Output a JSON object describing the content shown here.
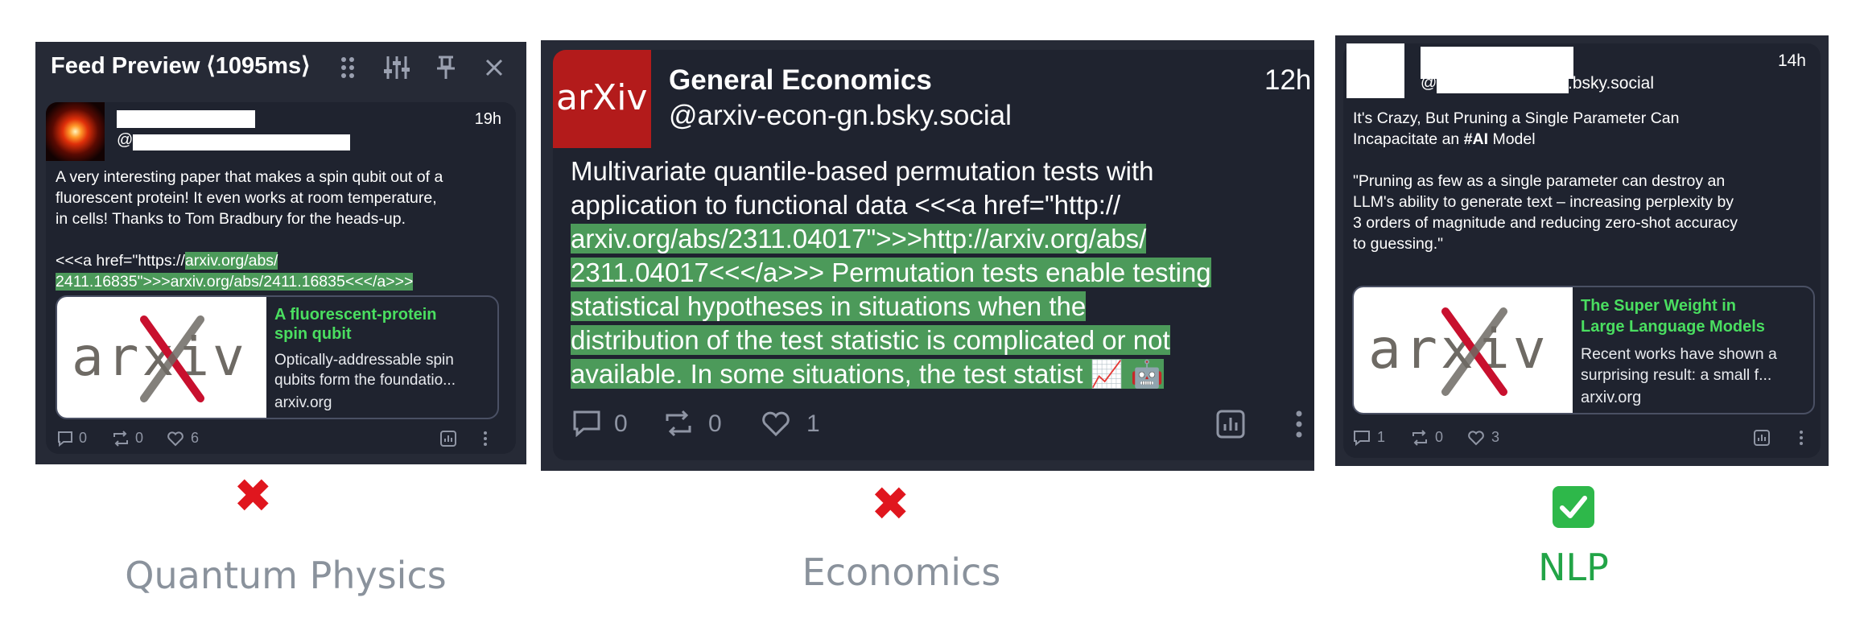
{
  "panel1": {
    "header_title": "Feed Preview ⟨1095ms⟩",
    "time": "19h",
    "handle_at": "@",
    "text_lines": [
      "A very interesting paper that makes a spin qubit out of a",
      "fluorescent protein! It even works at room temperature,",
      "in cells! Thanks to Tom Bradbury for the heads-up."
    ],
    "html_line1_plain": "<<<a href=\"https://",
    "html_line1_hl": "arxiv.org/abs/",
    "html_line2_hl": "2411.16835\">>>arxiv.org/abs/2411.16835<<</a>>>",
    "link_title": [
      "A fluorescent-protein",
      "spin qubit"
    ],
    "link_desc": [
      "Optically-addressable spin",
      "qubits form the foundatio..."
    ],
    "link_domain": "arxiv.org",
    "logo_text": "arxiv",
    "counts": {
      "replies": "0",
      "reposts": "0",
      "likes": "6"
    }
  },
  "panel2": {
    "avatar_text": "arXiv",
    "name": "General Economics",
    "handle": "@arxiv-econ-gn.bsky.social",
    "time": "12h",
    "line1": "Multivariate quantile-based permutation tests with",
    "line2": "application to functional data <<<a href=\"http://",
    "line3": "arxiv.org/abs/2311.04017\">>>http://arxiv.org/abs/",
    "line4": "2311.04017<<</a>>> Permutation tests enable testing",
    "line5": "statistical hypotheses in situations when the",
    "line6": "distribution of the test statistic is complicated or not",
    "line7": "available. In some situations, the test statist 📈 🤖",
    "counts": {
      "replies": "0",
      "reposts": "0",
      "likes": "1"
    }
  },
  "panel3": {
    "time": "14h",
    "handle_at": "@",
    "handle_suffix": ".bsky.social",
    "title_line1": "It's Crazy, But Pruning a Single Parameter Can",
    "title_line2_plain": "Incapacitate an ",
    "title_line2_bold": "#AI",
    "title_line2_end": " Model",
    "quote_lines": [
      "\"Pruning as few as a single parameter can destroy an",
      "LLM's ability to generate text – increasing perplexity by",
      "3 orders of magnitude and reducing zero-shot accuracy",
      "to guessing.\""
    ],
    "link_title": [
      "The Super Weight in",
      "Large Language Models"
    ],
    "link_desc": [
      "Recent works have shown a",
      "surprising result: a small f..."
    ],
    "link_domain": "arxiv.org",
    "logo_text": "arxiv",
    "counts": {
      "replies": "1",
      "reposts": "0",
      "likes": "3"
    }
  },
  "captions": {
    "left": "Quantum Physics",
    "middle": "Economics",
    "right": "NLP"
  },
  "marks": {
    "left": "✖",
    "middle": "✖",
    "right": "✅"
  },
  "colors": {
    "panel_bg": "#262a36",
    "card_bg": "#1f232f",
    "highlight": "#4c9a5a",
    "link_title": "#4ade60",
    "cross": "#e0161e",
    "caption_grey": "#8a929c",
    "caption_green": "#22a447"
  }
}
